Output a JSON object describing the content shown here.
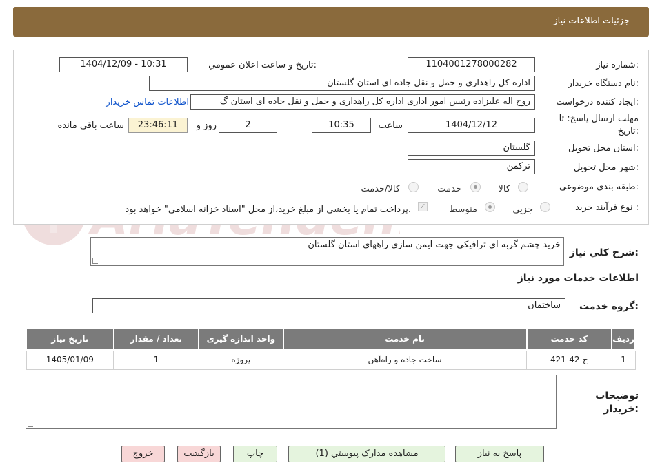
{
  "header": {
    "title": "جزئیات اطلاعات نیاز"
  },
  "form": {
    "need_number_label": "شماره نیاز:",
    "need_number_value": "1104001278000282",
    "announce_label": "تاریخ و ساعت اعلان عمومي:",
    "announce_value": "1404/12/09 - 10:31",
    "buyer_org_label": "نام دستگاه خریدار:",
    "buyer_org_value": "اداره کل راهداری و حمل و نقل جاده ای استان گلستان",
    "requester_label": "ایجاد کننده درخواست:",
    "requester_value": "روح اله علیزاده رئیس امور اداری اداره کل راهداری و حمل و نقل جاده ای استان گ",
    "contact_link": "اطلاعات تماس خریدار",
    "deadline_label_line1": "مهلت ارسال پاسخ: تا",
    "deadline_label_line2": "تاریخ:",
    "deadline_date": "1404/12/12",
    "time_label": "ساعت",
    "deadline_time": "10:35",
    "days_value": "2",
    "days_label": "روز و",
    "remaining_time": "23:46:11",
    "remaining_label": "ساعت باقي مانده",
    "province_label": "استان محل تحویل:",
    "province_value": "گلستان",
    "city_label": "شهر محل تحویل:",
    "city_value": "ترکمن",
    "category_label": "طبقه بندی موضوعی:",
    "category_options": [
      "کالا",
      "خدمت",
      "کالا/خدمت"
    ],
    "category_selected": "خدمت",
    "process_label": "نوع فرآیند خرید :",
    "process_options": [
      "جزيي",
      "متوسط"
    ],
    "process_selected": "متوسط",
    "payment_note": "پرداخت تمام یا بخشی از مبلغ خرید،از محل \"اسناد خزانه اسلامی\" خواهد بود."
  },
  "description": {
    "label": "شرح کلي نیاز:",
    "value": "خرید چشم گربه ای ترافیکی جهت ایمن سازی راههای استان گلستان"
  },
  "services": {
    "section_title": "اطلاعات خدمات مورد نیاز",
    "group_label": "گروه خدمت:",
    "group_value": "ساختمان",
    "columns": [
      "ردیف",
      "کد خدمت",
      "نام خدمت",
      "واحد اندازه گیری",
      "تعداد / مقدار",
      "تاریخ نیاز"
    ],
    "rows": [
      {
        "row": "1",
        "code": "ج-42-421",
        "name": "ساخت جاده و راه‌آهن",
        "unit": "پروژه",
        "qty": "1",
        "date": "1405/01/09"
      }
    ]
  },
  "buyer_notes": {
    "label_line1": "توضیحات",
    "label_line2": "خریدار:",
    "value": ""
  },
  "buttons": {
    "reply": "پاسخ به نیاز",
    "attachments": "مشاهده مدارک پیوستي (1)",
    "print": "چاپ",
    "back": "بازگشت",
    "exit": "خروج"
  },
  "watermark": {
    "text": "AriaTender.neT"
  },
  "colors": {
    "header": "#8a6a3c",
    "table_header": "#7b7b7b",
    "highlight": "#fbf3d3",
    "link": "#1155cc"
  }
}
